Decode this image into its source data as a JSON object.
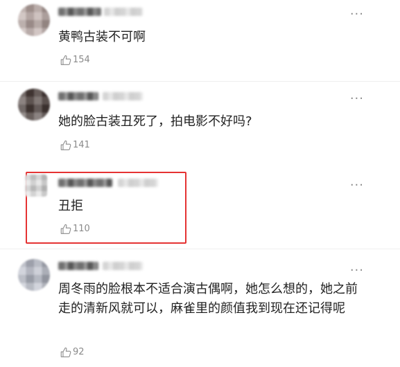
{
  "comments": [
    {
      "text": "黄鸭古装不可啊",
      "likes": "154",
      "more": "···"
    },
    {
      "text": "她的脸古装丑死了，拍电影不好吗?",
      "likes": "141",
      "more": "···"
    },
    {
      "text": "丑拒",
      "likes": "110",
      "more": "···",
      "highlighted": true
    },
    {
      "text": "周冬雨的脸根本不适合演古偶啊，她怎么想的，她之前走的清新风就可以，麻雀里的颜值我到现在还记得呢",
      "likes": "92",
      "more": "···"
    }
  ],
  "colors": {
    "highlight": "#e53232",
    "text": "#222222",
    "meta": "#8a8a8a"
  },
  "icons": {
    "like": "thumbs-up-icon",
    "more": "more-dots-icon",
    "avatar": "blurred-avatar"
  }
}
